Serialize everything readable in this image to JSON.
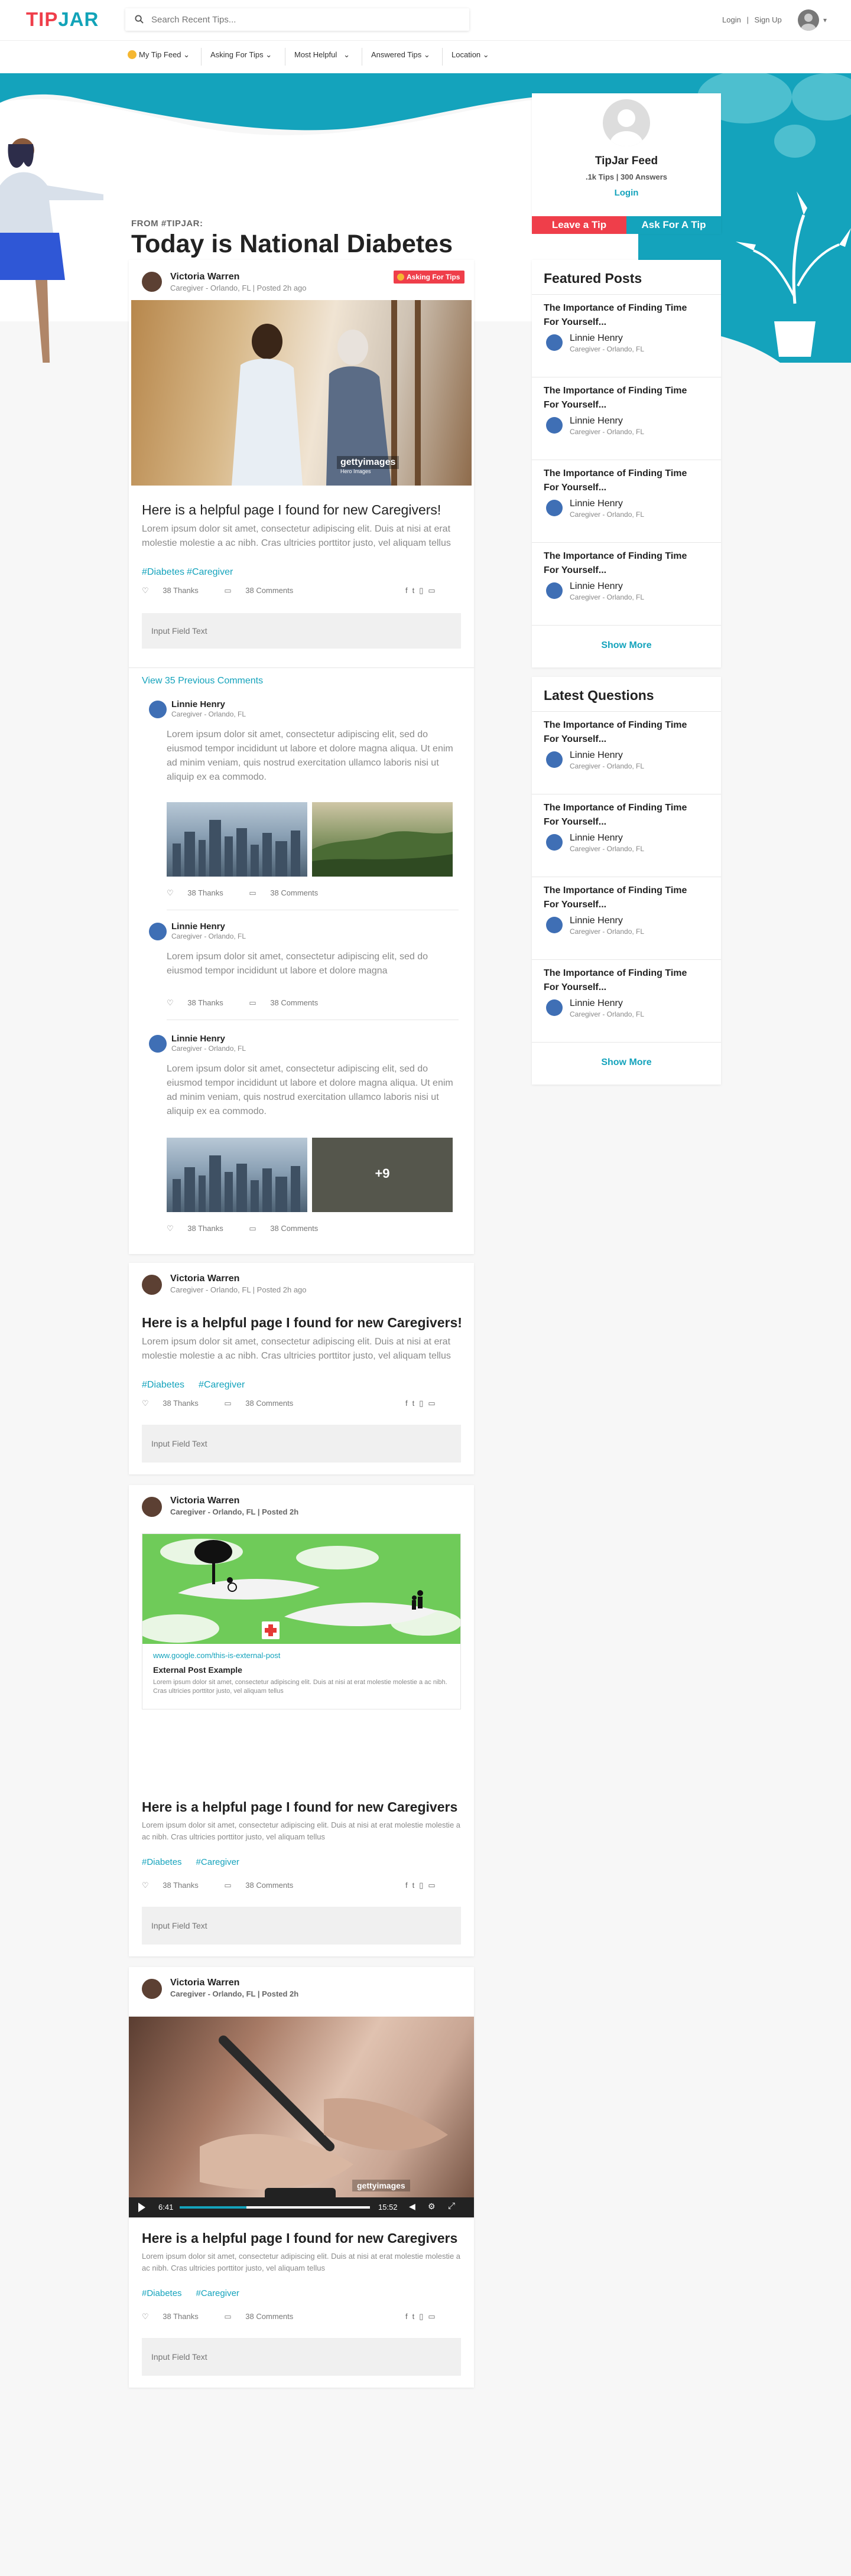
{
  "brand": {
    "logo_red": "TIP",
    "logo_teal": "JAR",
    "red": "#ef3e4a",
    "teal": "#14a3bc"
  },
  "search": {
    "placeholder": "Search Recent Tips...",
    "icon": "search-icon"
  },
  "top": {
    "login": "Login",
    "sep": "|",
    "signup": "Sign Up"
  },
  "nav": [
    "My Tip Feed",
    "Asking For Tips",
    "Most Helpful",
    "Answered Tips",
    "Location"
  ],
  "hero": {
    "from": "FROM #TIPJAR:",
    "title": "Today is National Diabetes Awareness Day"
  },
  "profile": {
    "title": "TipJar Feed",
    "stats": ".1k Tips | 300 Answers",
    "login": "Login",
    "leave": "Leave a Tip",
    "ask": "Ask For A Tip"
  },
  "featured": {
    "title": "Featured Posts",
    "show_more": "Show More",
    "items": [
      {
        "title": "The Importance of Finding Time For Yourself...",
        "name": "Linnie Henry",
        "meta": "Caregiver - Orlando, FL"
      },
      {
        "title": "The Importance of Finding Time For Yourself...",
        "name": "Linnie Henry",
        "meta": "Caregiver - Orlando, FL"
      },
      {
        "title": "The Importance of Finding Time For Yourself...",
        "name": "Linnie Henry",
        "meta": "Caregiver - Orlando, FL"
      },
      {
        "title": "The Importance of Finding Time For Yourself...",
        "name": "Linnie Henry",
        "meta": "Caregiver - Orlando, FL"
      }
    ]
  },
  "questions": {
    "title": "Latest Questions",
    "show_more": "Show More",
    "items": [
      {
        "title": "The Importance of Finding Time For Yourself...",
        "name": "Linnie Henry",
        "meta": "Caregiver - Orlando, FL"
      },
      {
        "title": "The Importance of Finding Time For Yourself...",
        "name": "Linnie Henry",
        "meta": "Caregiver - Orlando, FL"
      },
      {
        "title": "The Importance of Finding Time For Yourself...",
        "name": "Linnie Henry",
        "meta": "Caregiver - Orlando, FL"
      },
      {
        "title": "The Importance of Finding Time For Yourself...",
        "name": "Linnie Henry",
        "meta": "Caregiver - Orlando, FL"
      }
    ]
  },
  "post1": {
    "name": "Victoria Warren",
    "meta": "Caregiver - Orlando, FL  |  Posted 2h ago",
    "badge": "Asking For Tips",
    "watermark": "gettyimages",
    "watermark_sub": "Hero Images",
    "title": "Here is a helpful page I found for new Caregivers!",
    "body": "Lorem ipsum dolor sit amet, consectetur adipiscing elit. Duis at nisi at erat molestie molestie a ac nibh. Cras ultricies porttitor justo, vel aliquam tellus",
    "tags": [
      "#Diabetes",
      "#Caregiver"
    ],
    "thanks": "38 Thanks",
    "comments": "38 Comments",
    "field": "Input Field Text",
    "view_prev": "View 35 Previous Comments",
    "c1": {
      "name": "Linnie Henry",
      "meta": "Caregiver - Orlando, FL",
      "body": "Lorem ipsum dolor sit amet, consectetur adipiscing elit, sed do eiusmod tempor incididunt ut labore et dolore magna aliqua. Ut enim ad minim veniam, quis nostrud exercitation ullamco laboris nisi ut aliquip ex ea commodo.",
      "thanks": "38 Thanks",
      "comments": "38 Comments"
    },
    "c2": {
      "name": "Linnie Henry",
      "meta": "Caregiver - Orlando, FL",
      "body": "Lorem ipsum dolor sit amet, consectetur adipiscing elit, sed do eiusmod tempor incididunt ut labore et dolore magna",
      "thanks": "38 Thanks",
      "comments": "38 Comments"
    },
    "c3": {
      "name": "Linnie Henry",
      "meta": "Caregiver - Orlando, FL",
      "body": "Lorem ipsum dolor sit amet, consectetur adipiscing elit, sed do eiusmod tempor incididunt ut labore et dolore magna aliqua. Ut enim ad minim veniam, quis nostrud exercitation ullamco laboris nisi ut aliquip ex ea commodo.",
      "more": "+9",
      "thanks": "38 Thanks",
      "comments": "38 Comments"
    }
  },
  "post2": {
    "name": "Victoria Warren",
    "meta": "Caregiver - Orlando, FL  |  Posted 2h ago",
    "title": "Here is a helpful page I found for new Caregivers!",
    "body": "Lorem ipsum dolor sit amet, consectetur adipiscing elit. Duis at nisi at erat molestie molestie a ac nibh. Cras ultricies porttitor justo, vel aliquam tellus",
    "tags": [
      "#Diabetes",
      "#Caregiver"
    ],
    "thanks": "38 Thanks",
    "comments": "38 Comments",
    "field": "Input Field Text"
  },
  "post3": {
    "name": "Victoria Warren",
    "meta": "Caregiver - Orlando, FL  |  Posted 2h",
    "link_url": "www.google.com/this-is-external-post",
    "link_title": "External Post Example",
    "link_body": "Lorem ipsum dolor sit amet, consectetur adipiscing elit. Duis at nisi at erat molestie molestie a ac nibh. Cras ultricies porttitor justo, vel aliquam tellus",
    "title": "Here is a helpful page I found for new Caregivers",
    "body": "Lorem ipsum dolor sit amet, consectetur adipiscing elit. Duis at nisi at erat molestie molestie a ac nibh. Cras ultricies porttitor justo, vel aliquam tellus",
    "tags": [
      "#Diabetes",
      "#Caregiver"
    ],
    "thanks": "38 Thanks",
    "comments": "38 Comments",
    "field": "Input Field Text"
  },
  "post4": {
    "name": "Victoria Warren",
    "meta": "Caregiver - Orlando, FL  |  Posted 2h",
    "watermark": "gettyimages",
    "time_current": "6:41",
    "time_total": "15:52",
    "progress": 0.35,
    "title": "Here is a helpful page I found for new Caregivers",
    "body": "Lorem ipsum dolor sit amet, consectetur adipiscing elit. Duis at nisi at erat molestie molestie a ac nibh. Cras ultricies porttitor justo, vel aliquam tellus",
    "tags": [
      "#Diabetes",
      "#Caregiver"
    ],
    "thanks": "38 Thanks",
    "comments": "38 Comments",
    "field": "Input Field Text"
  }
}
